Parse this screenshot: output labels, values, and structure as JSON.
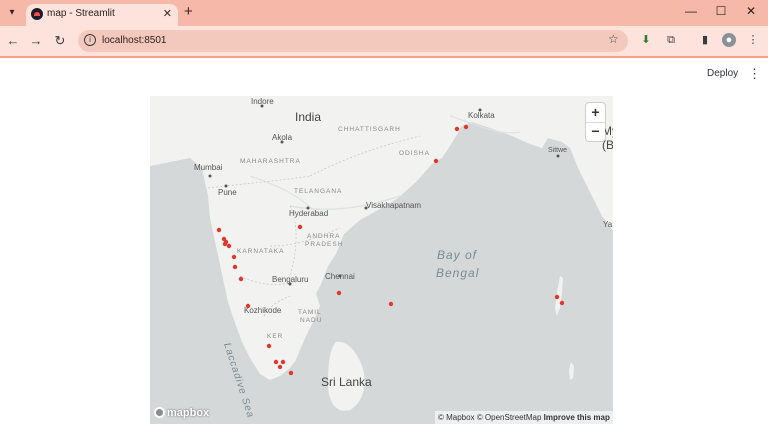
{
  "browser": {
    "tab_title": "map - Streamlit",
    "url": "localhost:8501"
  },
  "app": {
    "deploy_label": "Deploy"
  },
  "map": {
    "provider": "Mapbox",
    "zoom_in_label": "+",
    "zoom_out_label": "−",
    "logo_text": "mapbox",
    "attribution": {
      "mapbox": "© Mapbox",
      "osm": "© OpenStreetMap",
      "improve": "Improve this map"
    },
    "point_color": "#e0362c",
    "labels": {
      "country": [
        "India",
        "Sri Lanka"
      ],
      "states": [
        "CHHATTISGARH",
        "MAHARASHTRA",
        "ODISHA",
        "TELANGANA",
        "ANDHRA",
        "PRADESH",
        "KARNATAKA",
        "TAMIL",
        "NADU",
        "KER"
      ],
      "cities": [
        "Indore",
        "Kolkata",
        "Akola",
        "Mumbai",
        "Pune",
        "Hyderabad",
        "Visakhapatnam",
        "Bengaluru",
        "Chennai",
        "Kozhikode",
        "Sittwe"
      ],
      "water": [
        "Bay of",
        "Bengal",
        "Laccadive Sea"
      ],
      "edge": [
        "My",
        "(B",
        "Ya"
      ]
    }
  }
}
